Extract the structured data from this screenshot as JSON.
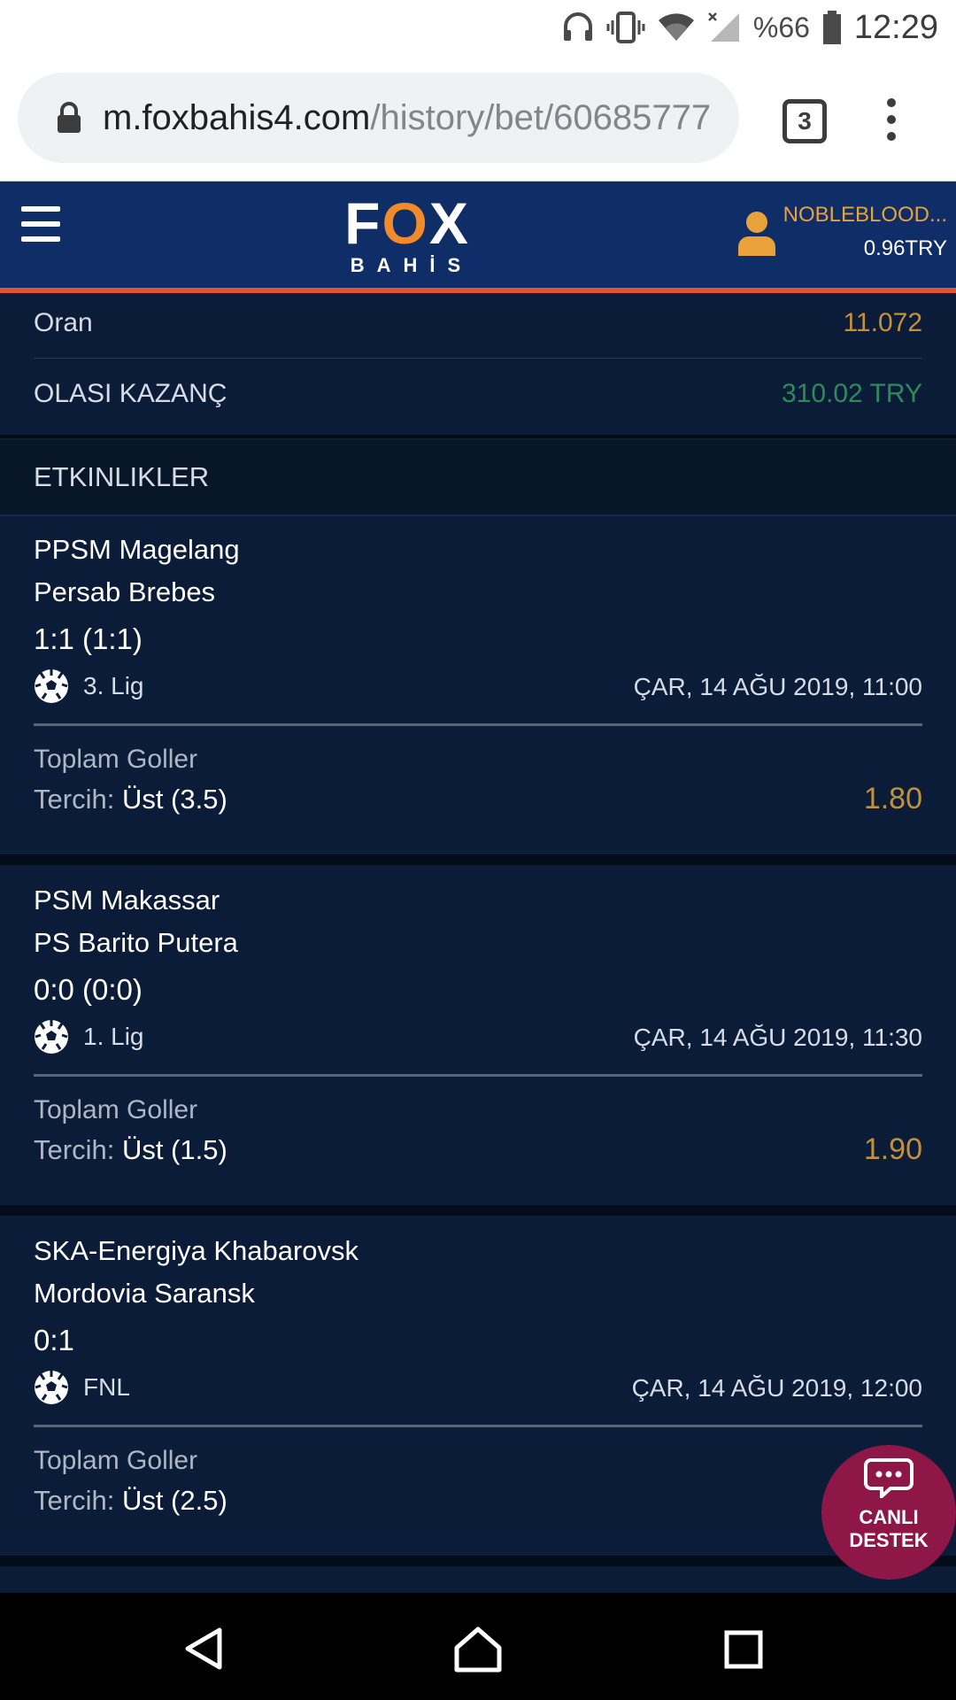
{
  "status_bar": {
    "battery": "%66",
    "time": "12:29"
  },
  "browser": {
    "url_host": "m.foxbahis4.com",
    "url_path": "/history/bet/60685777",
    "tab_count": "3"
  },
  "app_header": {
    "logo_main": "FOX",
    "logo_sub": "BAHİS",
    "username": "NOBLEBLOOD...",
    "balance": "0.96TRY"
  },
  "summary": {
    "oran_label": "Oran",
    "oran_value": "11.072",
    "kazanc_label": "OLASI KAZANÇ",
    "kazanc_value": "310.02 TRY"
  },
  "events_header": "ETKINLIKLER",
  "events": [
    {
      "team1": "PPSM Magelang",
      "team2": "Persab Brebes",
      "score": "1:1 (1:1)",
      "league": "3. Lig",
      "date": "ÇAR, 14 AĞU 2019, 11:00",
      "market": "Toplam Goller",
      "pick_label": "Tercih:",
      "pick_value": "Üst (3.5)",
      "odd": "1.80"
    },
    {
      "team1": "PSM Makassar",
      "team2": "PS Barito Putera",
      "score": "0:0 (0:0)",
      "league": "1. Lig",
      "date": "ÇAR, 14 AĞU 2019, 11:30",
      "market": "Toplam Goller",
      "pick_label": "Tercih:",
      "pick_value": "Üst (1.5)",
      "odd": "1.90"
    },
    {
      "team1": "SKA-Energiya Khabarovsk",
      "team2": "Mordovia Saransk",
      "score": "0:1",
      "league": "FNL",
      "date": "ÇAR, 14 AĞU 2019, 12:00",
      "market": "Toplam Goller",
      "pick_label": "Tercih:",
      "pick_value": "Üst (2.5)",
      "odd": ""
    }
  ],
  "support": {
    "line1": "CANLI",
    "line2": "DESTEK"
  },
  "icons": {
    "sport": "soccer-ball-icon",
    "user": "user-icon",
    "menu": "hamburger-menu-icon",
    "chat": "chat-bubble-icon"
  },
  "colors": {
    "header_bg": "#0f2d66",
    "accent_orange": "#e2542b",
    "odd_gold": "#c4903a",
    "win_green": "#2f8a5a",
    "support_bg": "#8e1748"
  }
}
